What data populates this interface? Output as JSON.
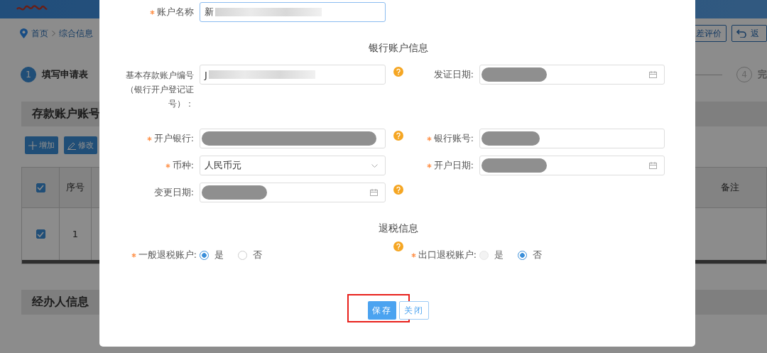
{
  "page": {
    "breadcrumb": [
      {
        "label": "首页"
      },
      {
        "label": "综合信息"
      }
    ],
    "top_buttons": [
      {
        "label": "差评价",
        "kind": "plain"
      },
      {
        "label": "返",
        "kind": "back"
      }
    ],
    "steps": [
      {
        "number": "1",
        "label": "填写申请表",
        "selected": true
      },
      {
        "number": "4",
        "label": "完",
        "selected": false
      }
    ],
    "sections": [
      {
        "title": "存款账户账号"
      },
      {
        "title": "经办人信息"
      }
    ],
    "toolbar": [
      {
        "label": "增加",
        "kind": "add"
      },
      {
        "label": "修改",
        "kind": "edit"
      }
    ],
    "table": {
      "columns": [
        {
          "kind": "check",
          "checked": true
        },
        {
          "kind": "text",
          "label": "序号"
        },
        {
          "kind": "text",
          "label": "备注"
        }
      ],
      "rows": [
        {
          "checked": true,
          "cells": [
            "1"
          ]
        }
      ]
    }
  },
  "dialog": {
    "account_name": {
      "label": "账户名称",
      "required": true,
      "value": "新",
      "blurred": true
    },
    "sections": [
      {
        "title": "银行账户信息",
        "rows": [
          [
            {
              "label": "基本存款账户编号（银行开户登记证号）：",
              "required": false,
              "kind": "text",
              "value": "J",
              "blurred": true,
              "help": true
            },
            {
              "label": "发证日期:",
              "required": false,
              "kind": "date",
              "redacted": true,
              "help": false
            }
          ],
          [
            {
              "label": "开户银行:",
              "required": true,
              "kind": "text",
              "redacted": true,
              "help": true
            },
            {
              "label": "银行账号:",
              "required": true,
              "kind": "text",
              "redacted": true,
              "help": false
            }
          ],
          [
            {
              "label": "币种:",
              "required": true,
              "kind": "select",
              "value": "人民币元",
              "help": false
            },
            {
              "label": "开户日期:",
              "required": true,
              "kind": "date",
              "redacted": true,
              "help": false
            }
          ],
          [
            {
              "label": "变更日期:",
              "required": false,
              "kind": "date",
              "redacted": true,
              "help": true
            }
          ]
        ]
      },
      {
        "title": "退税信息",
        "rows": [
          [
            {
              "label": "一般退税账户:",
              "required": true,
              "kind": "radio",
              "help": true,
              "options": [
                {
                  "label": "是",
                  "selected": true,
                  "disabled": false
                },
                {
                  "label": "否",
                  "selected": false,
                  "disabled": false
                }
              ]
            },
            {
              "label": "出口退税账户:",
              "required": true,
              "kind": "radio",
              "help": false,
              "options": [
                {
                  "label": "是",
                  "selected": false,
                  "disabled": true
                },
                {
                  "label": "否",
                  "selected": true,
                  "disabled": false
                }
              ]
            }
          ]
        ]
      }
    ],
    "buttons": [
      {
        "label": "保存",
        "kind": "primary",
        "highlighted": true
      },
      {
        "label": "关闭",
        "kind": "plain",
        "highlighted": false
      }
    ]
  }
}
